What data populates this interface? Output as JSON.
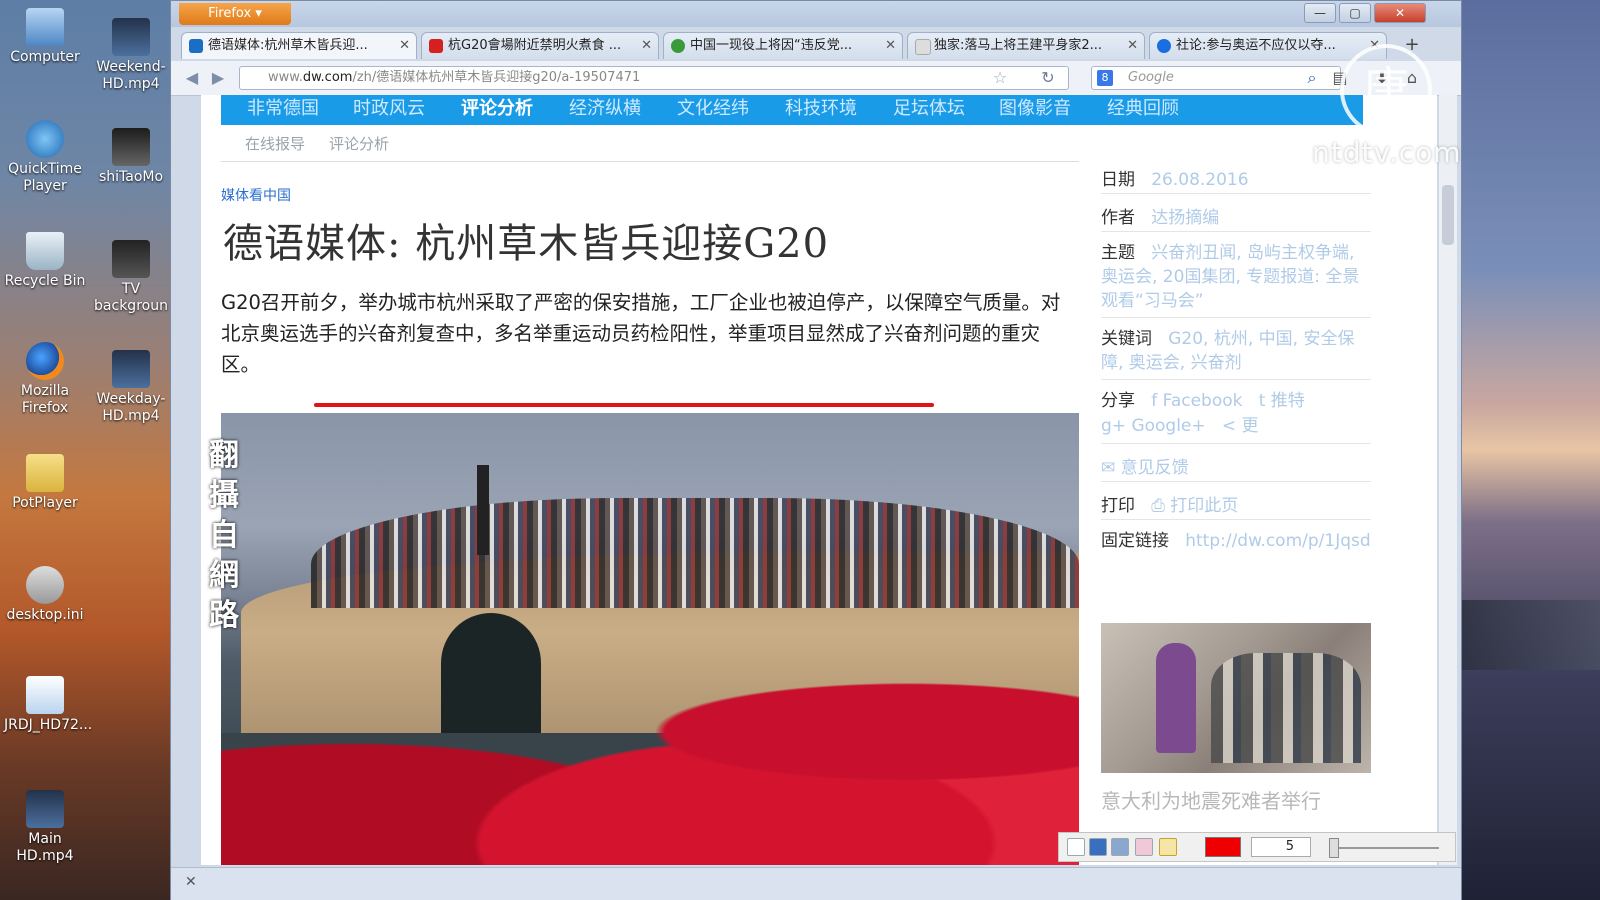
{
  "desktop": {
    "icons": [
      {
        "label": "Computer"
      },
      {
        "label": "Weekend-HD.mp4"
      },
      {
        "label": "QuickTime Player"
      },
      {
        "label": "shiTaoMo"
      },
      {
        "label": "Recycle Bin"
      },
      {
        "label": "TV backgroun"
      },
      {
        "label": "Mozilla Firefox"
      },
      {
        "label": "Weekday-HD.mp4"
      },
      {
        "label": "PotPlayer"
      },
      {
        "label": "desktop.ini"
      },
      {
        "label": "JRDJ_HD72..."
      },
      {
        "label": "Main HD.mp4"
      }
    ]
  },
  "browser": {
    "menu_label": "Firefox ▾",
    "window_controls": {
      "minimize": "—",
      "maximize": "▢",
      "close": "✕"
    },
    "tabs": [
      {
        "label": "德语媒体:杭州草木皆兵迎...",
        "active": true,
        "favicon_color": "#1a6fc4"
      },
      {
        "label": "杭G20會場附近禁明火煮食 ...",
        "active": false,
        "favicon_color": "#d62020"
      },
      {
        "label": "中国一现役上将因“违反党...",
        "active": false,
        "favicon_color": "#3a9a3a"
      },
      {
        "label": "独家:落马上将王建平身家2...",
        "active": false,
        "favicon_color": "#dddddd"
      },
      {
        "label": "社论:参与奥运不应仅以夺...",
        "active": false,
        "favicon_color": "#1a6fe0"
      }
    ],
    "new_tab": "+",
    "url": {
      "prefix": "www.",
      "domain": "dw.com",
      "path": "/zh/德语媒体杭州草木皆兵迎接g20/a-19507471"
    },
    "search": {
      "engine_icon": "8",
      "placeholder": "Google"
    }
  },
  "page": {
    "nav": [
      "非常德国",
      "时政风云",
      "评论分析",
      "经济纵横",
      "文化经纬",
      "科技环境",
      "足坛体坛",
      "图像影音",
      "经典回顾"
    ],
    "nav_active_index": 2,
    "subnav": [
      "在线报导",
      "评论分析"
    ],
    "kicker": "媒体看中国",
    "headline": "德语媒体: 杭州草木皆兵迎接G20",
    "lead": "G20召开前夕，举办城市杭州采取了严密的保安措施，工厂企业也被迫停产，以保障空气质量。对北京奥运选手的兴奋剂复查中，多名举重运动员药检阳性，举重项目显然成了兴奋剂问题的重灾区。",
    "overlay_vertical": "翻攝自網路",
    "meta": {
      "date_label": "日期",
      "date_value": "26.08.2016",
      "author_label": "作者",
      "author_value": "达扬摘编",
      "topic_label": "主题",
      "topic_value": "兴奋剂丑闻, 岛屿主权争端, 奥运会, 20国集团, 专题报道: 全景观看“习马会”",
      "keywords_label": "关键词",
      "keywords_value": "G20, 杭州, 中国, 安全保障, 奥运会, 兴奋剂",
      "share_label": "分享",
      "share_facebook": "f Facebook",
      "share_twitter": "t 推特",
      "share_google": "g+ Google+",
      "share_more": "< 更",
      "feedback": "✉ 意见反馈",
      "print_label": "打印",
      "print_value": "⎙ 打印此页",
      "permalink_label": "固定链接",
      "permalink_value": "http://dw.com/p/1Jqsd"
    },
    "thumb_caption": "意大利为地震死难者举行"
  },
  "drawing_toolbar": {
    "brush_size": "5",
    "color": "#e00000"
  },
  "statusbar": {
    "close": "✕"
  },
  "watermark": {
    "logo_glyph": "唐",
    "text": "ntdtv.com"
  }
}
